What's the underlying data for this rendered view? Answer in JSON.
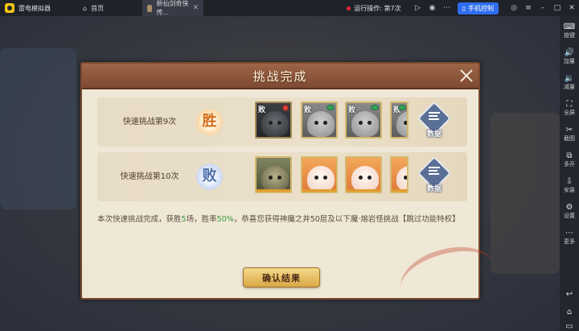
{
  "emulator": {
    "app_name": "雷电模拟器",
    "tabs": [
      {
        "label": "首页"
      },
      {
        "label": "新仙剑奇侠传..."
      }
    ],
    "status": "运行操作: 第7次",
    "control_label": "手机控制"
  },
  "sidebar": {
    "items": [
      {
        "label": "按键",
        "icon": "keyboard-icon",
        "glyph": "⌨"
      },
      {
        "label": "加量",
        "icon": "volume-up-icon",
        "glyph": "🔊"
      },
      {
        "label": "减量",
        "icon": "volume-down-icon",
        "glyph": "🔉"
      },
      {
        "label": "全屏",
        "icon": "fullscreen-icon",
        "glyph": "⛶"
      },
      {
        "label": "截图",
        "icon": "scissors-icon",
        "glyph": "✂"
      },
      {
        "label": "多开",
        "icon": "multi-instance-icon",
        "glyph": "⧉"
      },
      {
        "label": "安装",
        "icon": "install-icon",
        "glyph": "⇩"
      },
      {
        "label": "设置",
        "icon": "gear-icon",
        "glyph": "⚙"
      },
      {
        "label": "更多",
        "icon": "more-icon",
        "glyph": "⋯"
      }
    ]
  },
  "dialog": {
    "title": "挑战完成",
    "rows": [
      {
        "label": "快速挑战第9次",
        "result": "胜",
        "result_type": "win",
        "cards": [
          {
            "tag": "败",
            "style": "dark",
            "mark": "red"
          },
          {
            "tag": "败",
            "style": "gray",
            "mark": "green"
          },
          {
            "tag": "败",
            "style": "gray",
            "mark": "green"
          },
          {
            "tag": "败",
            "style": "gray",
            "mark": "green"
          }
        ],
        "data_label": "数据"
      },
      {
        "label": "快速挑战第10次",
        "result": "败",
        "result_type": "lose",
        "cards": [
          {
            "tag": "",
            "style": "olive",
            "mark": "none"
          },
          {
            "tag": "",
            "style": "orange",
            "mark": "none"
          },
          {
            "tag": "",
            "style": "orange",
            "mark": "none"
          },
          {
            "tag": "",
            "style": "orange",
            "mark": "none"
          }
        ],
        "data_label": "数据"
      }
    ],
    "summary": {
      "part1": "本次快速挑战完成，获胜",
      "wins": "5",
      "part2": "场，胜率",
      "win_rate": "50%",
      "part3": "，恭喜您获得神魔之井50层及以下魔·熔岩怪挑战【跳过功能特权】"
    },
    "confirm_label": "确认结果"
  },
  "colors": {
    "accent_blue": "#2f6df0",
    "win": "#d56a1c",
    "lose": "#4d6ea8",
    "highlight_green": "#3a9b3e"
  }
}
